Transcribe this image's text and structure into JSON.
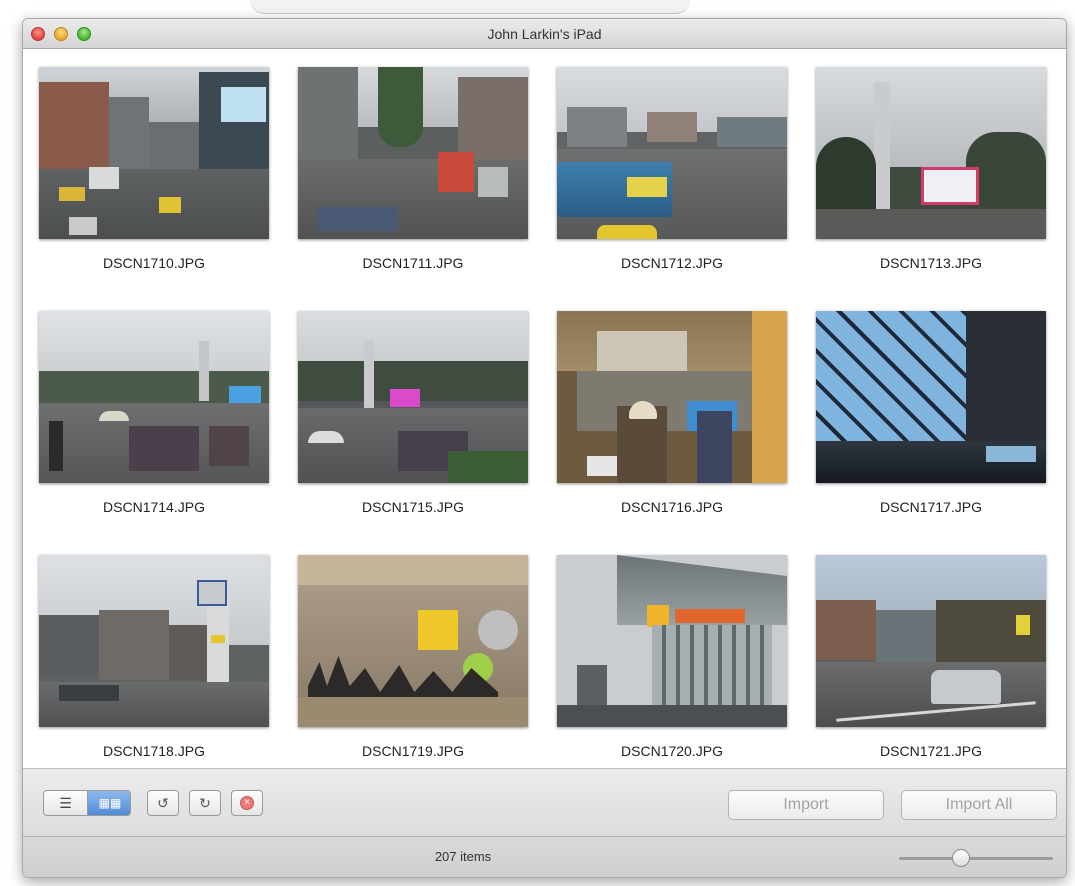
{
  "window": {
    "title": "John Larkin's iPad"
  },
  "photos": [
    {
      "name": "DSCN1710.JPG"
    },
    {
      "name": "DSCN1711.JPG"
    },
    {
      "name": "DSCN1712.JPG"
    },
    {
      "name": "DSCN1713.JPG"
    },
    {
      "name": "DSCN1714.JPG"
    },
    {
      "name": "DSCN1715.JPG"
    },
    {
      "name": "DSCN1716.JPG"
    },
    {
      "name": "DSCN1717.JPG"
    },
    {
      "name": "DSCN1718.JPG"
    },
    {
      "name": "DSCN1719.JPG"
    },
    {
      "name": "DSCN1720.JPG"
    },
    {
      "name": "DSCN1721.JPG"
    }
  ],
  "toolbar": {
    "list_view_icon": "list-icon",
    "grid_view_icon": "grid-icon",
    "rotate_left_icon": "rotate-left-icon",
    "rotate_right_icon": "rotate-right-icon",
    "delete_icon": "delete-icon",
    "import_label": "Import",
    "import_all_label": "Import All"
  },
  "status": {
    "items_text": "207 items",
    "thumbnail_size": 0.4
  },
  "colors": {
    "selected_segment": "#4f8bd8",
    "close": "#e0443e",
    "minimize": "#e9a824",
    "zoom": "#45b52f"
  }
}
